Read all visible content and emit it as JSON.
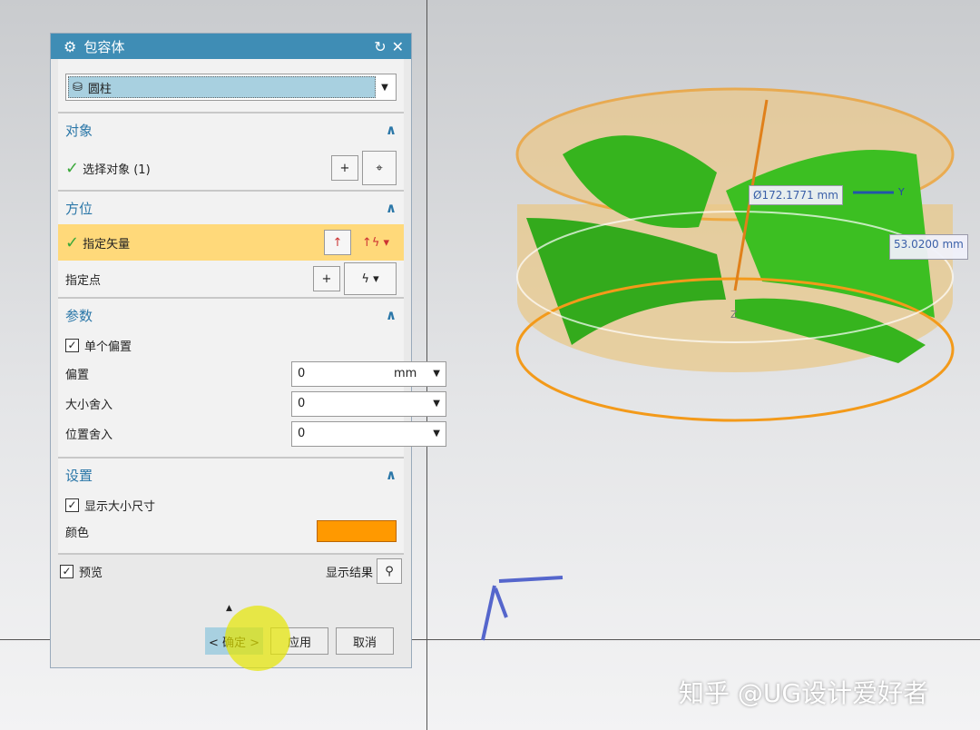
{
  "dialog": {
    "title": "包容体",
    "type_value": "圆柱",
    "sections": {
      "object": {
        "title": "对象",
        "select_label": "选择对象 (1)"
      },
      "orientation": {
        "title": "方位",
        "vector_label": "指定矢量",
        "point_label": "指定点"
      },
      "params": {
        "title": "参数",
        "single_offset": "单个偏置",
        "offset_label": "偏置",
        "offset_value": "0",
        "offset_unit": "mm",
        "size_round_label": "大小舍入",
        "size_round_value": "0",
        "pos_round_label": "位置舍入",
        "pos_round_value": "0"
      },
      "settings": {
        "title": "设置",
        "show_size": "显示大小尺寸",
        "color_label": "颜色",
        "color": "#ff9900"
      }
    },
    "preview_label": "预览",
    "show_result": "显示结果",
    "ok": "< 确定 >",
    "apply": "应用",
    "cancel": "取消"
  },
  "viewport": {
    "diameter": "Ø172.1771 mm",
    "height": "53.0200 mm",
    "axis_y": "Y",
    "axis_z": "Z"
  },
  "watermark": "知乎 @UG设计爱好者",
  "colors": {
    "title_bar": "#3f8db5",
    "highlight": "#ffd97a",
    "model": "#3cb521",
    "bounding": "#f0a030"
  }
}
